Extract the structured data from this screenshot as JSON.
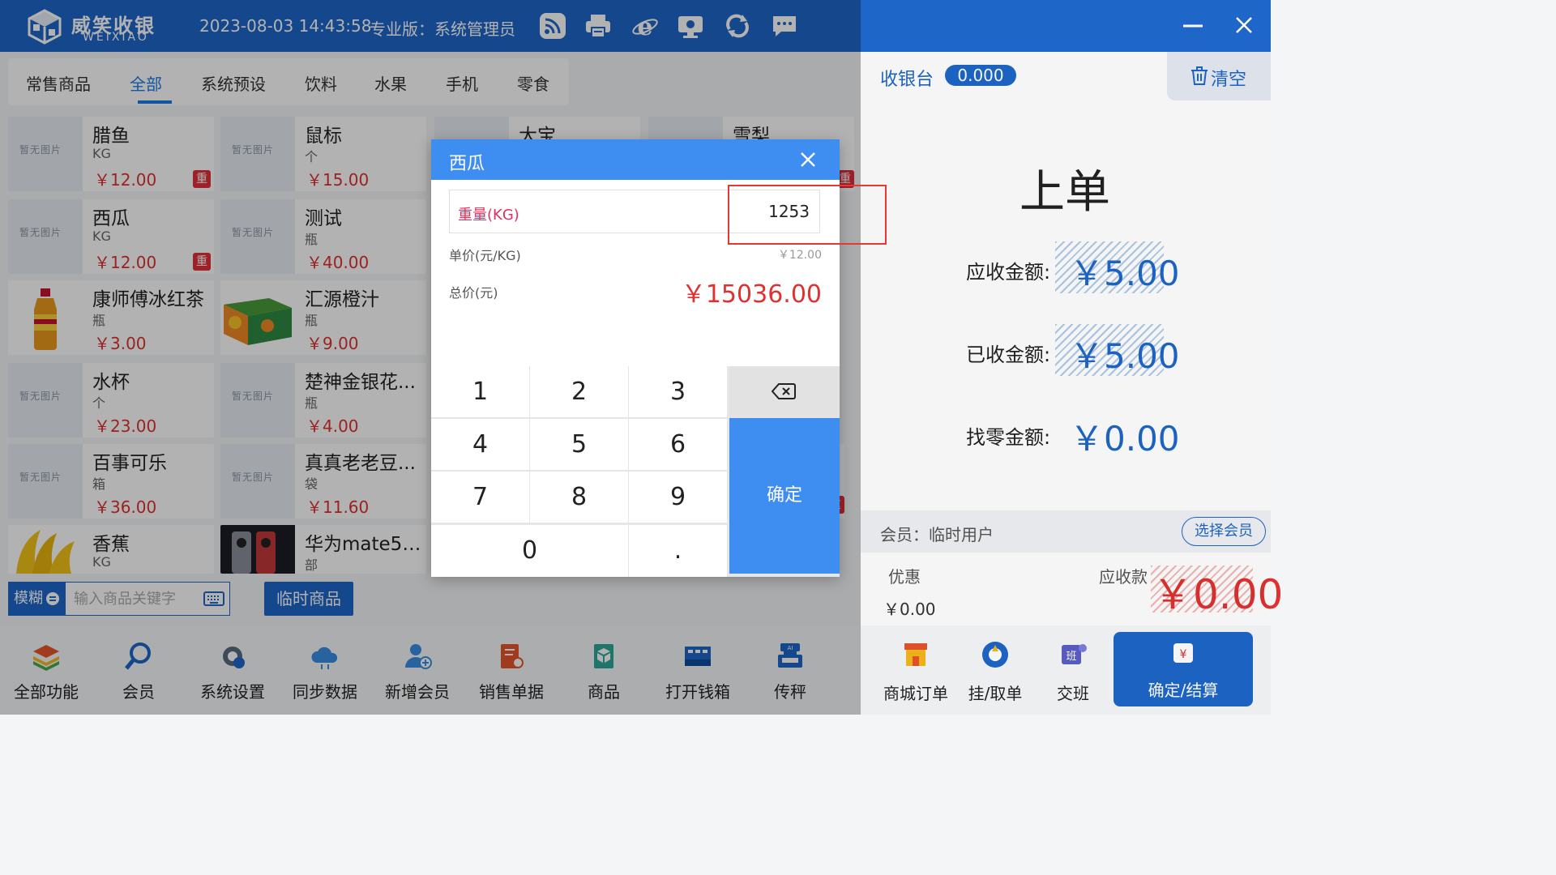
{
  "header": {
    "brand_cn": "威笑收银",
    "brand_en": "WEIXIAO",
    "datetime": "2023-08-03 14:43:58",
    "edition": "专业版：系统管理员",
    "icons": [
      "wifi-rss-icon",
      "printer-icon",
      "browser-icon",
      "remote-desktop-icon",
      "sync-icon",
      "chat-icon"
    ]
  },
  "categories": {
    "tabs": [
      "常售商品",
      "全部",
      "系统预设",
      "饮料",
      "水果",
      "手机",
      "零食"
    ],
    "active": "全部"
  },
  "placeholder_text": "暂无图片",
  "products": [
    {
      "name": "腊鱼",
      "unit": "KG",
      "price": "￥12.00",
      "badge": "重"
    },
    {
      "name": "鼠标",
      "unit": "个",
      "price": "￥15.00",
      "badge": ""
    },
    {
      "name": "大宝",
      "unit": "",
      "price": "",
      "badge": ""
    },
    {
      "name": "雪梨",
      "unit": "",
      "price": "",
      "badge": "重"
    },
    {
      "name": "西瓜",
      "unit": "KG",
      "price": "￥12.00",
      "badge": "重"
    },
    {
      "name": "测试",
      "unit": "瓶",
      "price": "￥40.00",
      "badge": ""
    },
    {
      "name": "康师傅冰红茶",
      "unit": "瓶",
      "price": "￥3.00",
      "badge": ""
    },
    {
      "name": "汇源橙汁",
      "unit": "瓶",
      "price": "￥9.00",
      "badge": ""
    },
    {
      "name": "水杯",
      "unit": "个",
      "price": "￥23.00",
      "badge": ""
    },
    {
      "name": "楚神金银花...",
      "unit": "瓶",
      "price": "￥4.00",
      "badge": ""
    },
    {
      "name": "百事可乐",
      "unit": "箱",
      "price": "￥36.00",
      "badge": ""
    },
    {
      "name": "真真老老豆...",
      "unit": "袋",
      "price": "￥11.60",
      "badge": ""
    },
    {
      "name": "香蕉",
      "unit": "KG",
      "price": "",
      "badge": ""
    },
    {
      "name": "华为mate50...",
      "unit": "部",
      "price": "",
      "badge": ""
    }
  ],
  "search": {
    "mode": "模糊",
    "placeholder": "输入商品关键字",
    "temp_goods": "临时商品"
  },
  "functions": [
    "全部功能",
    "会员",
    "系统设置",
    "同步数据",
    "新增会员",
    "销售单据",
    "商品",
    "打开钱箱",
    "传秤"
  ],
  "right": {
    "cashier_label": "收银台",
    "cashier_value": "0.000",
    "clear": "清空",
    "order_title": "上单",
    "receivable_label": "应收金额:",
    "receivable_value": "￥5.00",
    "received_label": "已收金额:",
    "received_value": "￥5.00",
    "change_label": "找零金额:",
    "change_value": "￥0.00",
    "member_text": "会员：临时用户",
    "member_btn": "选择会员",
    "discount_label": "优惠",
    "discount_value": "￥0.00",
    "due_label": "应收款",
    "due_value": "￥0.00",
    "buttons": [
      "商城订单",
      "挂/取单",
      "交班"
    ],
    "settle": "确定/结算"
  },
  "dialog": {
    "title": "西瓜",
    "weight_label": "重量(KG)",
    "weight_value": "1253",
    "unit_price_label": "单价(元/KG)",
    "unit_price_value": "￥12.00",
    "total_label": "总价(元)",
    "total_value": "￥15036.00",
    "keys": [
      "1",
      "2",
      "3",
      "4",
      "5",
      "6",
      "7",
      "8",
      "9",
      "0",
      "."
    ],
    "confirm": "确定"
  }
}
